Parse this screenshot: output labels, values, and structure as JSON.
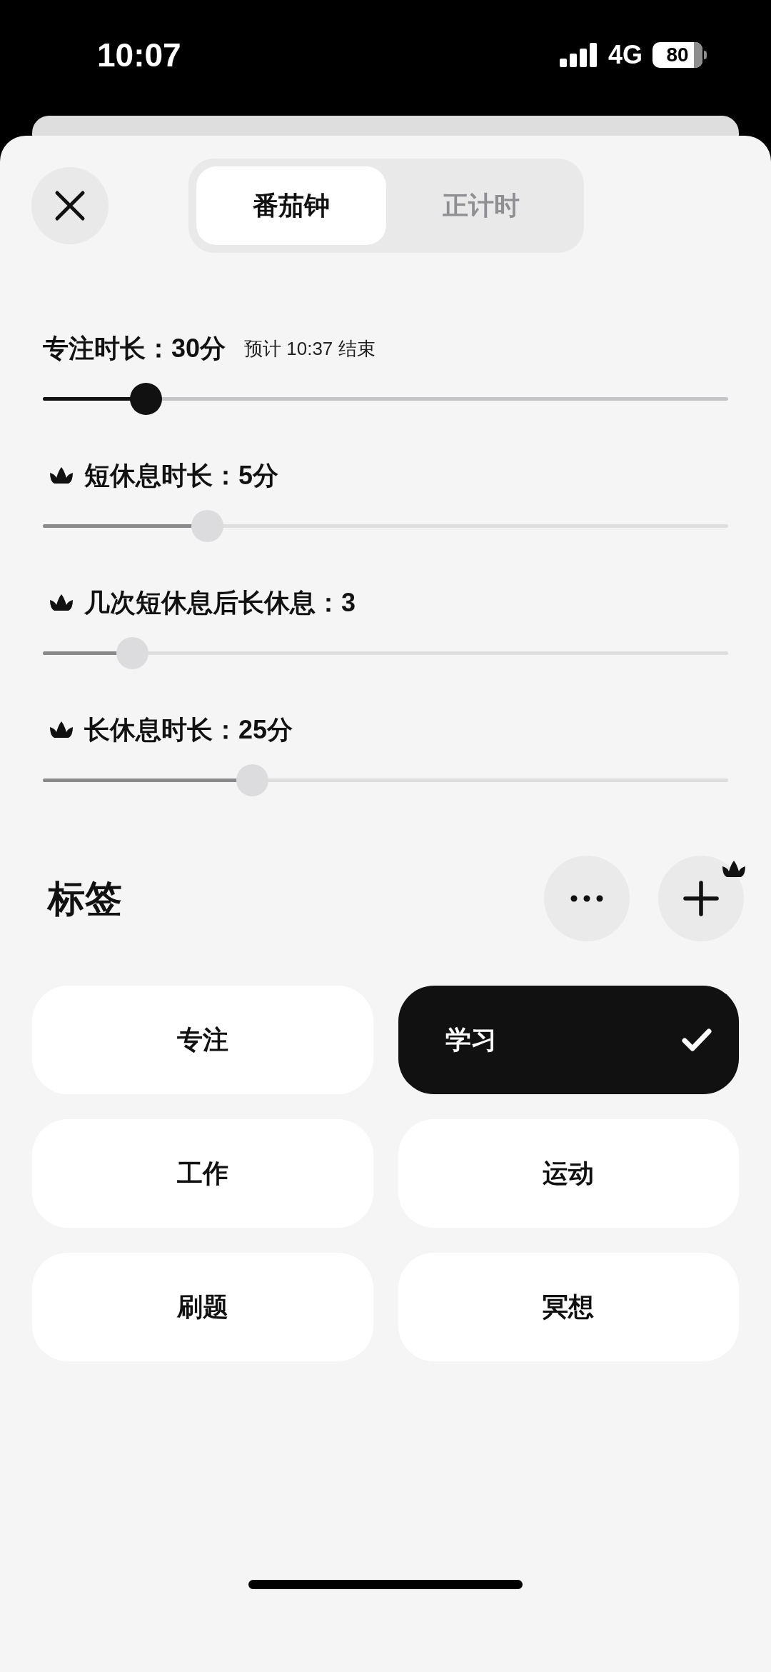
{
  "status_bar": {
    "time": "10:07",
    "network": "4G",
    "battery": "80"
  },
  "mode_tabs": [
    {
      "label": "番茄钟",
      "selected": true
    },
    {
      "label": "正计时",
      "selected": false
    }
  ],
  "sliders": [
    {
      "label": "专注时长：30分",
      "note": "预计 10:37 结束",
      "locked": false,
      "level": 0.15
    },
    {
      "label": "短休息时长：5分",
      "locked": true,
      "level": 0.24
    },
    {
      "label": "几次短休息后长休息：3",
      "locked": true,
      "level": 0.13
    },
    {
      "label": "长休息时长：25分",
      "locked": true,
      "level": 0.305
    }
  ],
  "tags_section": {
    "title": "标签",
    "add_locked": true
  },
  "tags": [
    {
      "label": "专注",
      "selected": false
    },
    {
      "label": "学习",
      "selected": true
    },
    {
      "label": "工作",
      "selected": false
    },
    {
      "label": "运动",
      "selected": false
    },
    {
      "label": "刷题",
      "selected": false
    },
    {
      "label": "冥想",
      "selected": false
    }
  ]
}
